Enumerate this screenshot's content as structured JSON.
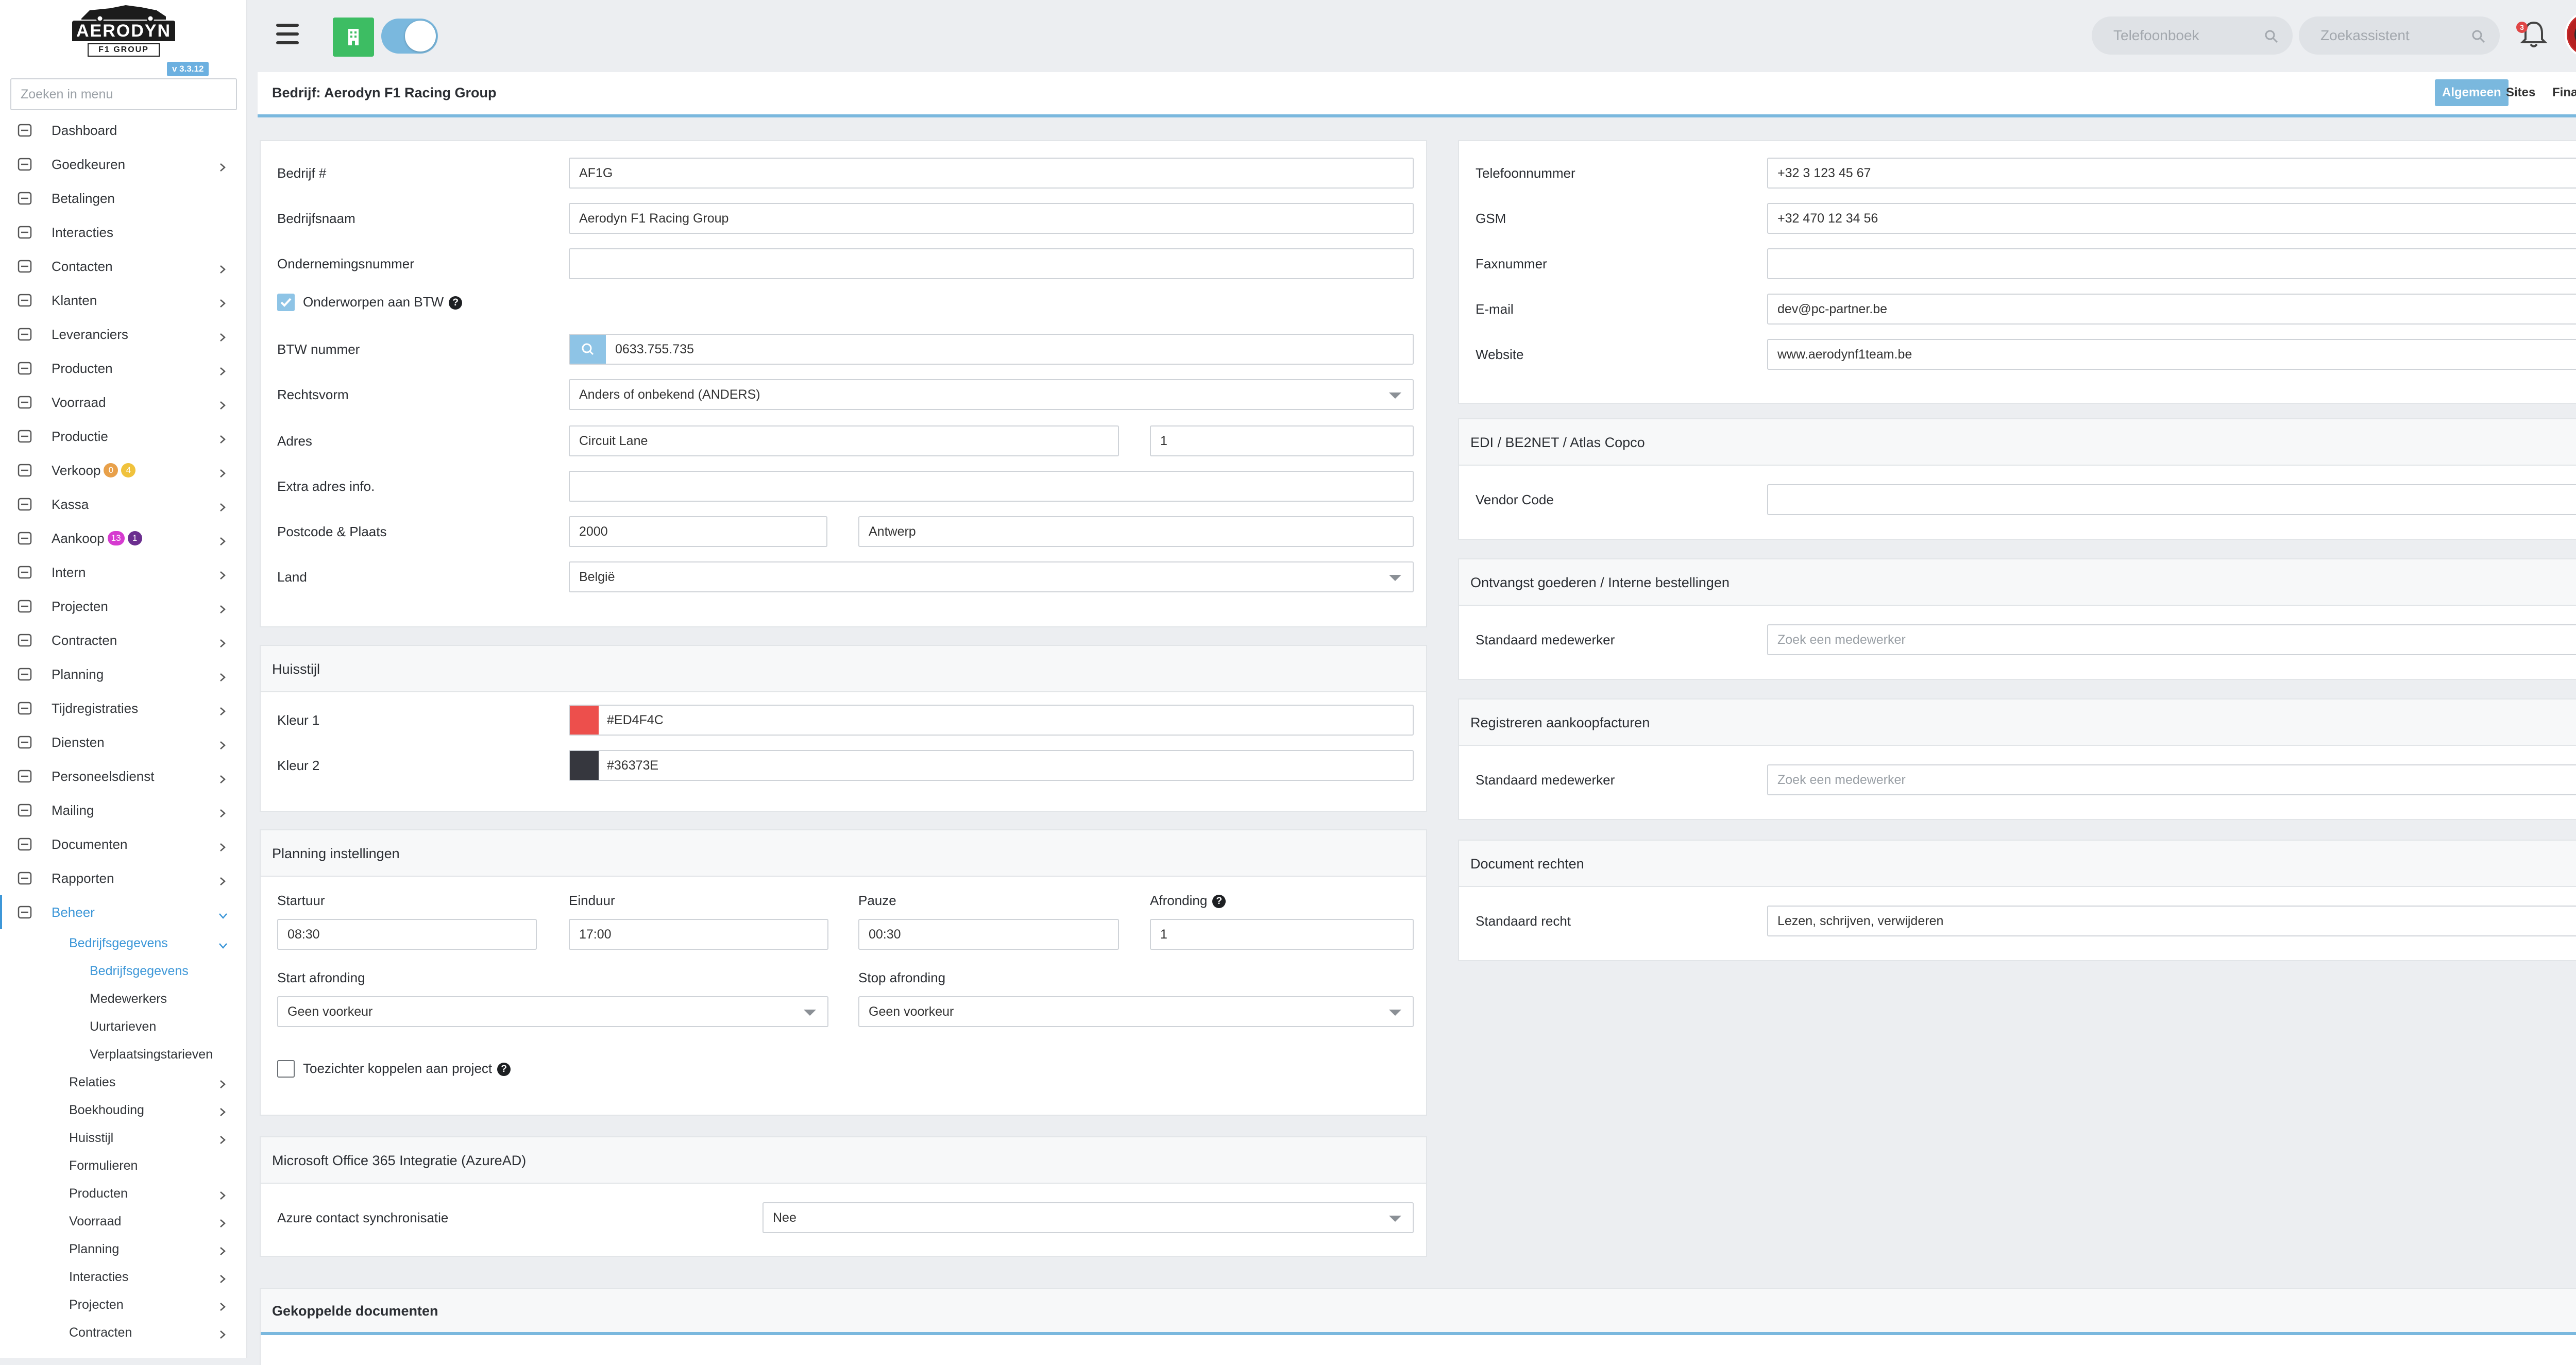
{
  "sidebar": {
    "logo_text": "AERODYN",
    "logo_sub": "F1 GROUP",
    "version": "v 3.3.12",
    "search_placeholder": "Zoeken in menu",
    "items": [
      {
        "label": "Dashboard",
        "icon": "dashboard-icon",
        "chevron": false
      },
      {
        "label": "Goedkeuren",
        "icon": "user-check-icon",
        "chevron": true
      },
      {
        "label": "Betalingen",
        "icon": "credit-card-icon",
        "chevron": false
      },
      {
        "label": "Interacties",
        "icon": "chat-bubbles-icon",
        "chevron": false
      },
      {
        "label": "Contacten",
        "icon": "contact-card-icon",
        "chevron": true
      },
      {
        "label": "Klanten",
        "icon": "user-icon",
        "chevron": true
      },
      {
        "label": "Leveranciers",
        "icon": "truck-icon",
        "chevron": true
      },
      {
        "label": "Producten",
        "icon": "box-icon",
        "chevron": true
      },
      {
        "label": "Voorraad",
        "icon": "boxes-icon",
        "chevron": true
      },
      {
        "label": "Productie",
        "icon": "gears-icon",
        "chevron": true
      },
      {
        "label": "Verkoop",
        "icon": "euro-icon",
        "chevron": true,
        "badges": [
          "0",
          "4"
        ]
      },
      {
        "label": "Kassa",
        "icon": "basket-icon",
        "chevron": true
      },
      {
        "label": "Aankoop",
        "icon": "cart-icon",
        "chevron": true,
        "badges": [
          "13",
          "1"
        ]
      },
      {
        "label": "Intern",
        "icon": "users-icon",
        "chevron": true
      },
      {
        "label": "Projecten",
        "icon": "project-tree-icon",
        "chevron": true
      },
      {
        "label": "Contracten",
        "icon": "contract-icon",
        "chevron": true
      },
      {
        "label": "Planning",
        "icon": "calendar-icon",
        "chevron": true
      },
      {
        "label": "Tijdregistraties",
        "icon": "clock-icon",
        "chevron": true
      },
      {
        "label": "Diensten",
        "icon": "repeat-icon",
        "chevron": true
      },
      {
        "label": "Personeelsdienst",
        "icon": "employee-icon",
        "chevron": true
      },
      {
        "label": "Mailing",
        "icon": "paper-plane-icon",
        "chevron": true
      },
      {
        "label": "Documenten",
        "icon": "folder-icon",
        "chevron": true
      },
      {
        "label": "Rapporten",
        "icon": "chart-line-icon",
        "chevron": true
      },
      {
        "label": "Beheer",
        "icon": "wrench-icon",
        "chevron": true,
        "expanded": true
      }
    ],
    "sub_items": [
      {
        "label": "Bedrijfsgegevens",
        "level": 1,
        "chevron": true,
        "expanded": true
      },
      {
        "label": "Bedrijfsgegevens",
        "level": 2,
        "chevron": false,
        "active": true
      },
      {
        "label": "Medewerkers",
        "level": 2,
        "chevron": false
      },
      {
        "label": "Uurtarieven",
        "level": 2,
        "chevron": false
      },
      {
        "label": "Verplaatsingstarieven",
        "level": 2,
        "chevron": false
      },
      {
        "label": "Relaties",
        "level": 1,
        "chevron": true
      },
      {
        "label": "Boekhouding",
        "level": 1,
        "chevron": true
      },
      {
        "label": "Huisstijl",
        "level": 1,
        "chevron": true
      },
      {
        "label": "Formulieren",
        "level": 1,
        "chevron": false
      },
      {
        "label": "Producten",
        "level": 1,
        "chevron": true
      },
      {
        "label": "Voorraad",
        "level": 1,
        "chevron": true
      },
      {
        "label": "Planning",
        "level": 1,
        "chevron": true
      },
      {
        "label": "Interacties",
        "level": 1,
        "chevron": true
      },
      {
        "label": "Projecten",
        "level": 1,
        "chevron": true
      },
      {
        "label": "Contracten",
        "level": 1,
        "chevron": true
      }
    ]
  },
  "topbar": {
    "phonebook_placeholder": "Telefoonboek",
    "assistant_placeholder": "Zoekassistent",
    "notification_count": "3"
  },
  "header": {
    "title": "Bedrijf: Aerodyn F1 Racing Group",
    "tabs": [
      "Algemeen",
      "Sites",
      "Financieel"
    ]
  },
  "general": {
    "company_no_label": "Bedrijf #",
    "company_no": "AF1G",
    "company_name_label": "Bedrijfsnaam",
    "company_name": "Aerodyn F1 Racing Group",
    "enterprise_no_label": "Ondernemingsnummer",
    "enterprise_no": "",
    "vat_subject_label": "Onderworpen aan BTW",
    "vat_no_label": "BTW nummer",
    "vat_no": "0633.755.735",
    "legal_form_label": "Rechtsvorm",
    "legal_form": "Anders of onbekend (ANDERS)",
    "address_label": "Adres",
    "street": "Circuit Lane",
    "house_no": "1",
    "extra_address_label": "Extra adres info.",
    "extra_address": "",
    "postal_city_label": "Postcode & Plaats",
    "postal_code": "2000",
    "city": "Antwerp",
    "country_label": "Land",
    "country": "België"
  },
  "contact": {
    "phone_label": "Telefoonnummer",
    "phone": "+32 3 123 45 67",
    "gsm_label": "GSM",
    "gsm": "+32 470 12 34 56",
    "fax_label": "Faxnummer",
    "fax": "",
    "email_label": "E-mail",
    "email": "dev@pc-partner.be",
    "website_label": "Website",
    "website": "www.aerodynf1team.be"
  },
  "style": {
    "title": "Huisstijl",
    "color1_label": "Kleur 1",
    "color1": "#ED4F4C",
    "color2_label": "Kleur 2",
    "color2": "#36373E"
  },
  "planning": {
    "title": "Planning instellingen",
    "start_label": "Startuur",
    "start": "08:30",
    "end_label": "Einduur",
    "end": "17:00",
    "pause_label": "Pauze",
    "pause": "00:30",
    "rounding_label": "Afronding",
    "rounding": "1",
    "start_rounding_label": "Start afronding",
    "start_rounding": "Geen voorkeur",
    "stop_rounding_label": "Stop afronding",
    "stop_rounding": "Geen voorkeur",
    "supervisors_label": "Toezichter koppelen aan project"
  },
  "azure": {
    "title": "Microsoft Office 365 Integratie (AzureAD)",
    "sync_label": "Azure contact synchronisatie",
    "sync": "Nee"
  },
  "edi": {
    "title": "EDI / BE2NET / Atlas Copco",
    "vendor_label": "Vendor Code",
    "vendor": ""
  },
  "receipt": {
    "title": "Ontvangst goederen / Interne bestellingen",
    "employee_label": "Standaard medewerker",
    "employee_placeholder": "Zoek een medewerker"
  },
  "invoices": {
    "title": "Registreren aankoopfacturen",
    "employee_label": "Standaard medewerker",
    "employee_placeholder": "Zoek een medewerker"
  },
  "rights": {
    "title": "Document rechten",
    "default_label": "Standaard recht",
    "default": "Lezen, schrijven, verwijderen"
  },
  "linked_docs": {
    "title": "Gekoppelde documenten"
  },
  "colors": {
    "accent": "#3d97d8",
    "accent_light": "#7ab8de",
    "green": "#3dbd63",
    "badge_orange": "#e8a04a",
    "badge_yellow": "#f0c23c",
    "badge_magenta": "#d63bd0",
    "badge_purple": "#6b2e8f"
  }
}
